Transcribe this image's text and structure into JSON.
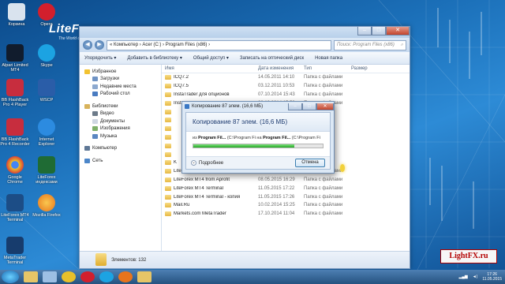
{
  "desktop": {
    "logo": "LiteForex",
    "logo_sub": "The World of Finance",
    "icons": [
      {
        "label": "Корзина",
        "color": "#d9e3ee"
      },
      {
        "label": "Opera",
        "color": "#d21f2d"
      },
      {
        "label": "Skype",
        "color": "#1ca3e2"
      },
      {
        "label": "Alpari Limited MT4",
        "color": "#111c2d"
      },
      {
        "label": "BB FlashBack Pro 4 Player",
        "color": "#c72d3e"
      },
      {
        "label": "WSCP",
        "color": "#2a5da8"
      },
      {
        "label": "BB FlashBack Pro 4 Recorder",
        "color": "#c72d3e"
      },
      {
        "label": "Internet Explorer",
        "color": "#2c8be0"
      },
      {
        "label": "Google Chrome",
        "color": "#e9c02a"
      },
      {
        "label": "LiteForex индексами",
        "color": "#1f6b34"
      },
      {
        "label": "LiteForex MT4 Terminal",
        "color": "#1c4d86"
      },
      {
        "label": "Mozilla Firefox",
        "color": "#e8741c"
      },
      {
        "label": "MetaTrader Terminal",
        "color": "#173c6d"
      }
    ]
  },
  "explorer": {
    "breadcrumb": "« Компьютер › Acer (C:) › Program Files (x86) ›",
    "search_placeholder": "Поиск: Program Files (x86)",
    "toolbar": [
      "Упорядочить ▾",
      "Добавить в библиотеку ▾",
      "Общий доступ ▾",
      "Записать на оптический диск",
      "Новая папка"
    ],
    "nav": {
      "favorites": "Избранное",
      "favorites_items": [
        "Загрузки",
        "Недавние места",
        "Рабочий стол"
      ],
      "libraries": "Библиотеки",
      "libraries_items": [
        "Видео",
        "Документы",
        "Изображения",
        "Музыка"
      ],
      "computer": "Компьютер",
      "network": "Сеть"
    },
    "columns": [
      "Имя",
      "Дата изменения",
      "Тип",
      "Размер"
    ],
    "rows": [
      {
        "name": "ICQ7.2",
        "date": "14.05.2011 14:10",
        "type": "Папка с файлами"
      },
      {
        "name": "ICQ7.5",
        "date": "03.12.2011 10:53",
        "type": "Папка с файлами"
      },
      {
        "name": "InstaTrader для опционов",
        "date": "07.10.2014 15:43",
        "type": "Папка с файлами"
      },
      {
        "name": "InstaTrader золото",
        "date": "08.10.2014 15:53",
        "type": "Папка с файлами"
      },
      {
        "name": "",
        "date": "",
        "type": ""
      },
      {
        "name": "",
        "date": "",
        "type": ""
      },
      {
        "name": "",
        "date": "",
        "type": ""
      },
      {
        "name": "",
        "date": "",
        "type": ""
      },
      {
        "name": "",
        "date": "",
        "type": ""
      },
      {
        "name": "",
        "date": "",
        "type": ""
      },
      {
        "name": "K",
        "date": "",
        "type": ""
      },
      {
        "name": "LiteForex с индексами",
        "date": "08.05.2015 8:55",
        "type": "Папка с файлами"
      },
      {
        "name": "LiteForex MT4 from Aprofit",
        "date": "08.05.2015 16:29",
        "type": "Папка с файлами"
      },
      {
        "name": "LiteForex MT4 Terminal",
        "date": "11.05.2015 17:22",
        "type": "Папка с файлами"
      },
      {
        "name": "LiteForex MT4 Terminal - копия",
        "date": "11.05.2015 17:26",
        "type": "Папка с файлами"
      },
      {
        "name": "Mail.Ru",
        "date": "10.02.2014 15:25",
        "type": "Папка с файлами"
      },
      {
        "name": "Markets.com MetaTrader",
        "date": "17.10.2014 11:04",
        "type": "Папка с файлами"
      }
    ],
    "status": "Элементов: 132"
  },
  "copy_dialog": {
    "title": "Копирование 87 элем. (16,6 МБ)",
    "heading": "Копирование 87 элем. (16,6 МБ)",
    "from_label": "из",
    "source": "Program Fil...",
    "source_path": "(C:\\Program Fi",
    "to_label": "на",
    "dest": "Program Fil...",
    "dest_path": "(C:\\Program Fi",
    "progress": 0.78,
    "details": "Подробнее",
    "cancel": "Отмена"
  },
  "taskbar": {
    "time": "17:26",
    "date": "11.05.2015"
  },
  "watermark": "LightFX.ru"
}
